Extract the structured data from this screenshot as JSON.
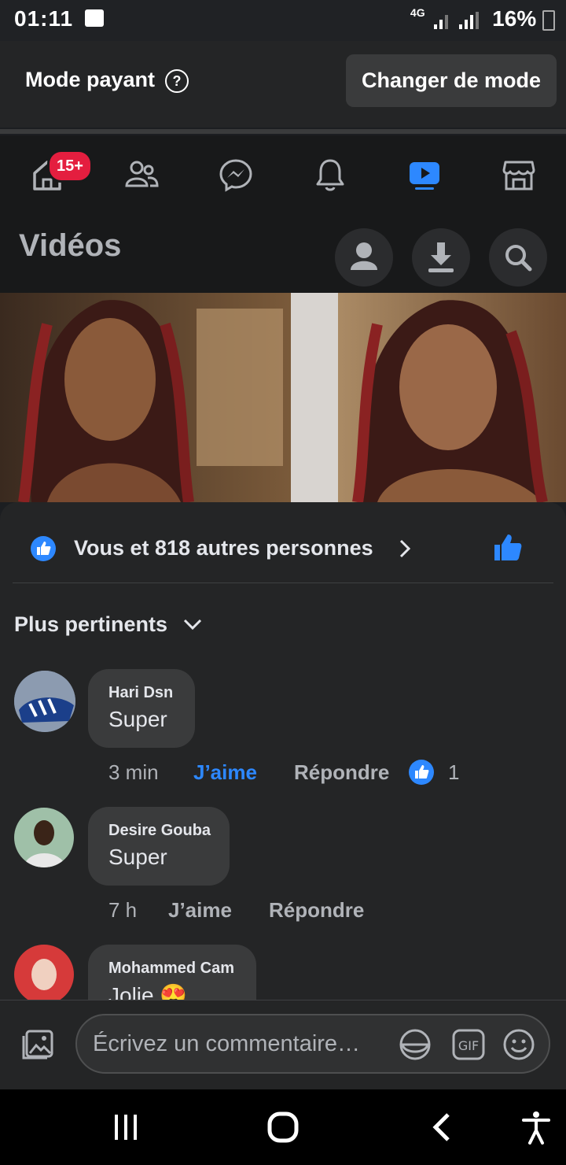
{
  "status": {
    "time": "01:11",
    "network": "4G",
    "battery": "16%"
  },
  "mode_bar": {
    "label": "Mode payant",
    "help_icon": "question-circle-icon",
    "button": "Changer de mode"
  },
  "nav": {
    "badge": "15+",
    "icons": [
      "home-icon",
      "friends-icon",
      "messenger-icon",
      "bell-icon",
      "video-icon",
      "marketplace-icon"
    ],
    "active": "video-icon",
    "active_color": "#2d88ff"
  },
  "header": {
    "title": "Vidéos",
    "buttons": [
      "profile-icon",
      "download-icon",
      "search-icon"
    ]
  },
  "reactions": {
    "text": "Vous et 818 autres personnes"
  },
  "sort": {
    "label": "Plus pertinents"
  },
  "comments": [
    {
      "name": "Hari Dsn",
      "text": "Super",
      "time": "3 min",
      "like": "J’aime",
      "reply": "Répondre",
      "reaction_count": "1"
    },
    {
      "name": "Desire Gouba",
      "text": "Super",
      "time": "7 h",
      "like": "J’aime",
      "reply": "Répondre"
    },
    {
      "name": "Mohammed Cam",
      "text": "Jolie 😍"
    }
  ],
  "input": {
    "placeholder": "Écrivez un commentaire…",
    "icons": [
      "photo-icon",
      "sticker-icon",
      "gif-icon",
      "emoji-icon"
    ]
  },
  "colors": {
    "accent": "#2d88ff",
    "badge": "#e41e3f",
    "background": "#242526"
  }
}
